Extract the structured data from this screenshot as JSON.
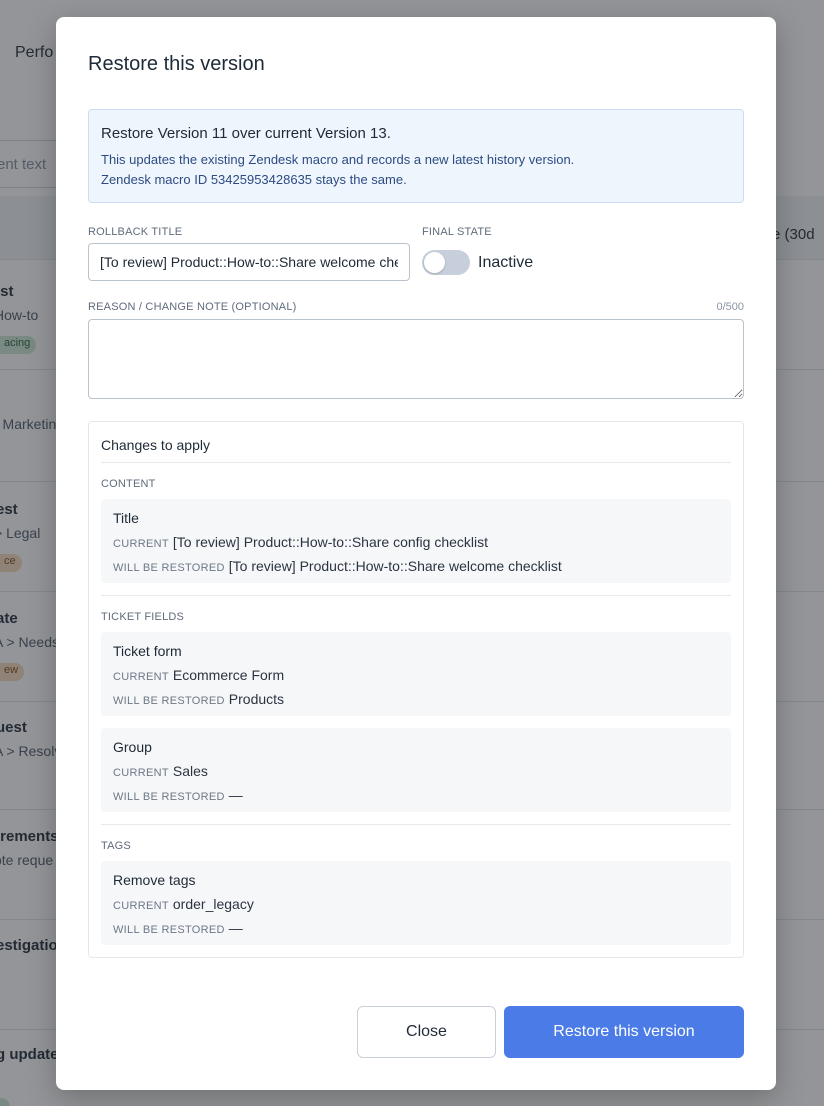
{
  "background": {
    "page_title": "Perfo",
    "search_placeholder": "ent text",
    "column_right": "e (30d",
    "rows": [
      {
        "title": "ist",
        "sub": "How-to",
        "badge": "acing"
      },
      {
        "title": "",
        "sub": "- Marketin",
        "badge": ""
      },
      {
        "title": "est",
        "sub": "> Legal",
        "badge": "ce"
      },
      {
        "title": "ate",
        "sub": "A > Needs",
        "badge": "ew"
      },
      {
        "title": "uest",
        "sub": "A > Resolv",
        "badge": ""
      },
      {
        "title": "irements",
        "sub": "ote reque",
        "badge": ""
      },
      {
        "title": "estigatio",
        "sub": "",
        "badge": ""
      },
      {
        "title": "g update",
        "sub": "",
        "badge": ""
      }
    ]
  },
  "modal": {
    "title": "Restore this version",
    "info": {
      "line1": "Restore Version 11 over current Version 13.",
      "line2": "This updates the existing Zendesk macro and records a new latest history version.",
      "line3": "Zendesk macro ID 53425953428635 stays the same."
    },
    "rollback_title_label": "ROLLBACK TITLE",
    "rollback_title_value": "[To review] Product::How-to::Share welcome checklist",
    "final_state_label": "FINAL STATE",
    "final_state_value": "Inactive",
    "reason_label": "REASON / CHANGE NOTE (OPTIONAL)",
    "reason_counter": "0/500",
    "changes": {
      "title": "Changes to apply",
      "current_key": "CURRENT",
      "restored_key": "WILL BE RESTORED",
      "sections": [
        {
          "label": "CONTENT",
          "items": [
            {
              "title": "Title",
              "current": "[To review] Product::How-to::Share config checklist",
              "restored": "[To review] Product::How-to::Share welcome checklist"
            }
          ]
        },
        {
          "label": "TICKET FIELDS",
          "items": [
            {
              "title": "Ticket form",
              "current": "Ecommerce Form",
              "restored": "Products"
            },
            {
              "title": "Group",
              "current": "Sales",
              "restored": "—"
            }
          ]
        },
        {
          "label": "TAGS",
          "items": [
            {
              "title": "Remove tags",
              "current": "order_legacy",
              "restored": "—"
            }
          ]
        }
      ]
    },
    "close_label": "Close",
    "restore_label": "Restore this version"
  },
  "colors": {
    "primary": "#4a7be6",
    "info_bg": "#eef5fd",
    "info_text": "#2d4b82",
    "toggle_off": "#c6cfdb"
  }
}
